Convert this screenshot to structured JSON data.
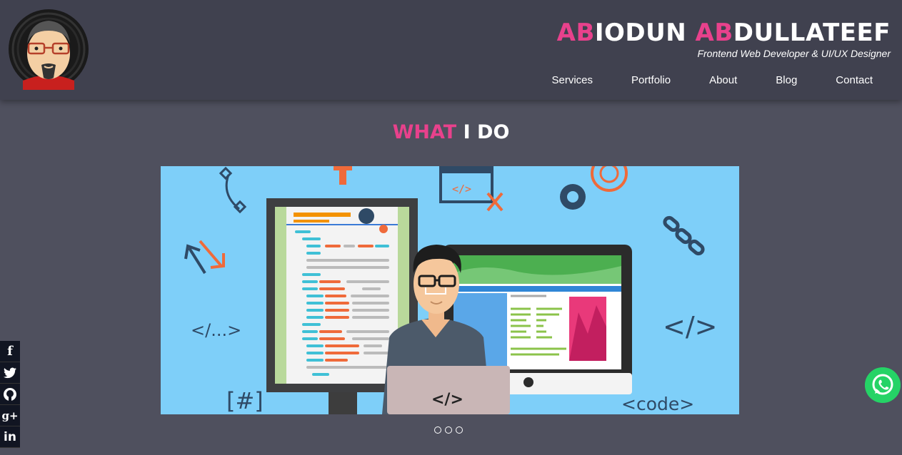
{
  "brand": {
    "title_part1_pink": "AB",
    "title_part1_white": "IODUN ",
    "title_part2_pink": "AB",
    "title_part2_white": "DULLATEEF",
    "subtitle": "Frontend Web Developer & UI/UX Designer"
  },
  "nav": {
    "items": [
      "Services",
      "Portfolio",
      "About",
      "Blog",
      "Contact"
    ]
  },
  "section": {
    "title_pink": "WHAT",
    "title_white": " I DO"
  },
  "hero": {
    "code_tag_left": "</...>",
    "code_tag_right": "</>",
    "hash_tag": "[#]",
    "code_word": "<code>",
    "laptop_tag": "</>",
    "browser_tag": "</>"
  },
  "carousel": {
    "slides": 3,
    "active": 0
  },
  "social": {
    "items": [
      "facebook-icon",
      "twitter-icon",
      "github-icon",
      "google-plus-icon",
      "linkedin-icon"
    ],
    "glyphs": [
      "f",
      "🐦",
      "",
      "g+",
      "in"
    ]
  },
  "colors": {
    "accent": "#e8418c",
    "header_bg": "#40414f",
    "page_bg": "#4f505e",
    "hero_bg": "#7ecff9",
    "whatsapp": "#25d366"
  }
}
